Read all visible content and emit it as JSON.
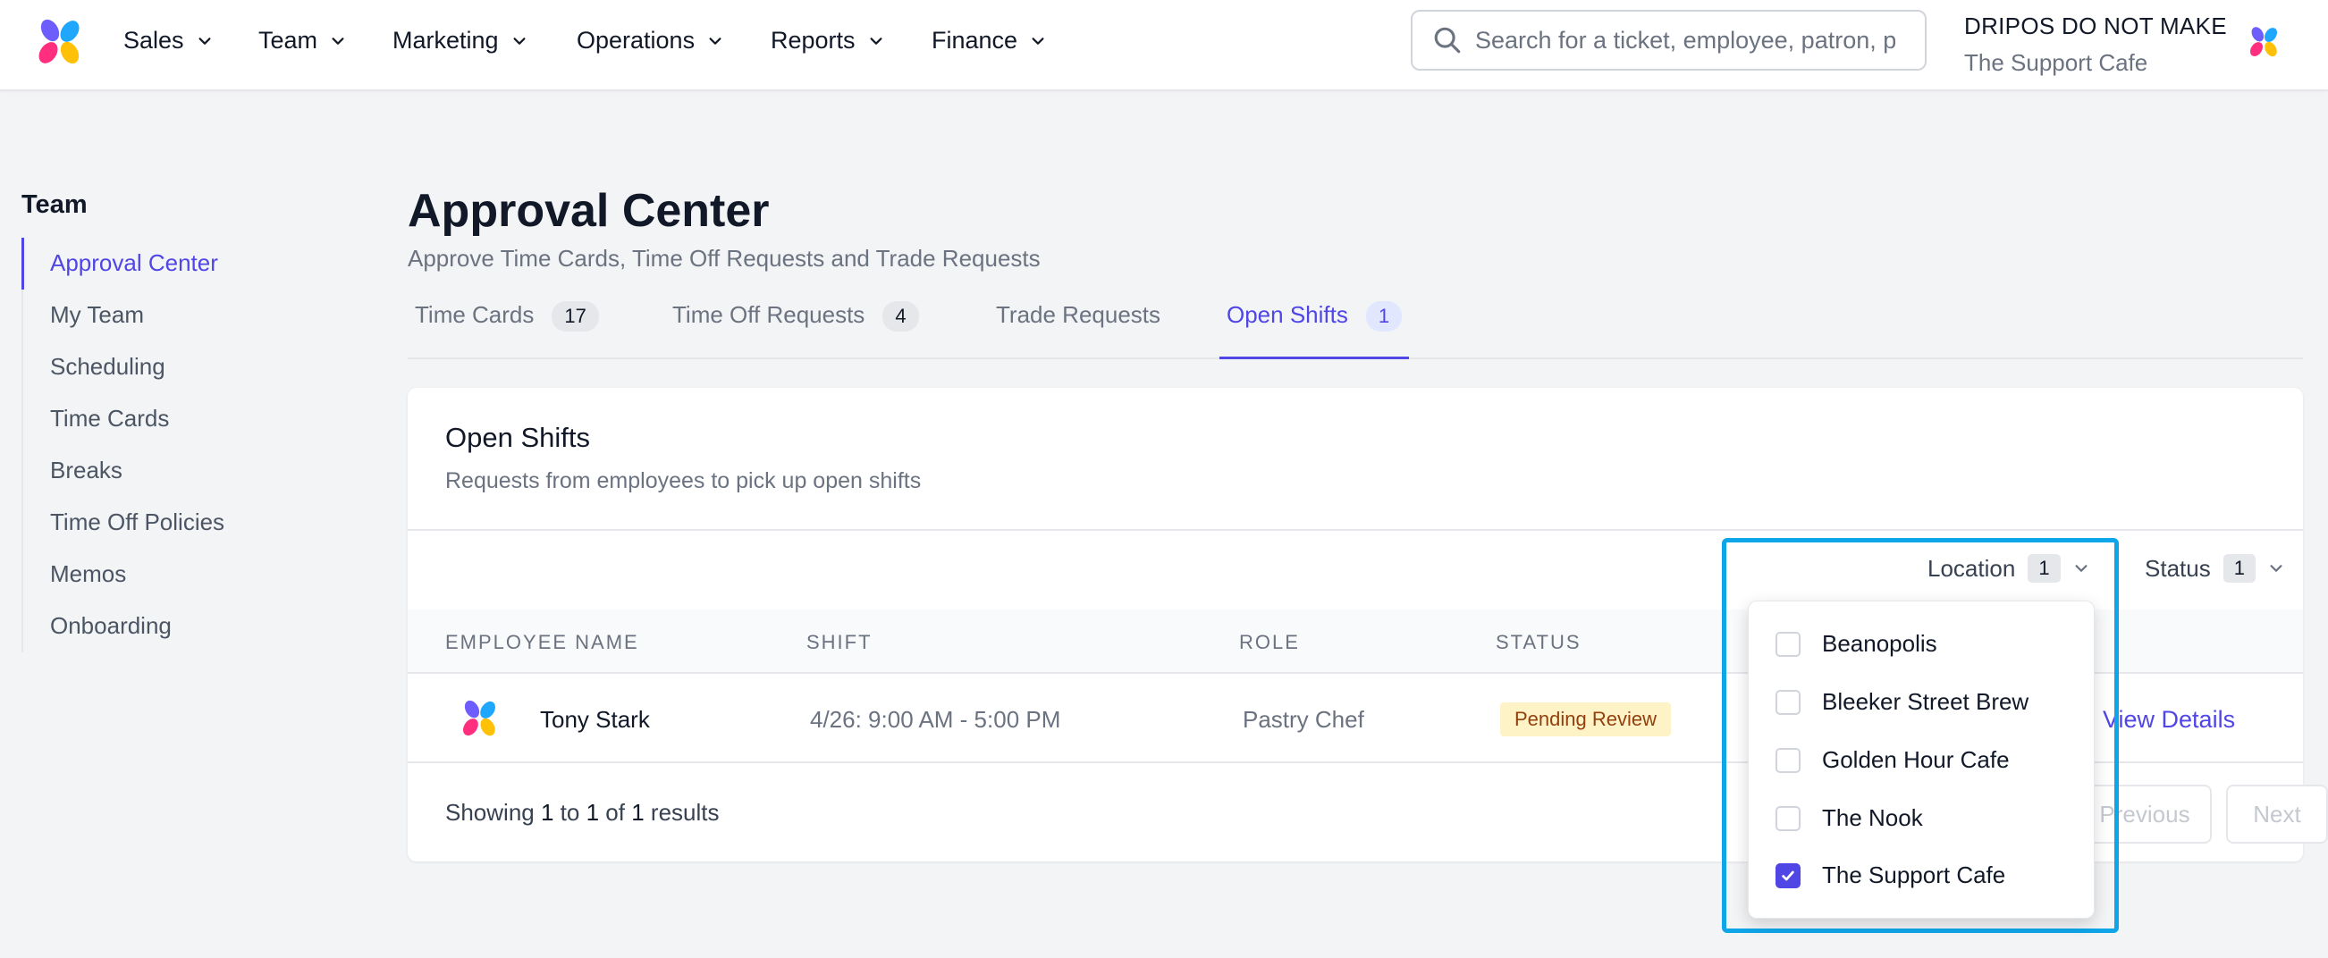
{
  "nav": {
    "items": [
      {
        "label": "Sales"
      },
      {
        "label": "Team"
      },
      {
        "label": "Marketing"
      },
      {
        "label": "Operations"
      },
      {
        "label": "Reports"
      },
      {
        "label": "Finance"
      }
    ],
    "search_placeholder": "Search for a ticket, employee, patron, p",
    "account_name": "DRIPOS DO NOT MAKE",
    "account_location": "The Support Cafe"
  },
  "sidebar": {
    "title": "Team",
    "items": [
      {
        "label": "Approval Center",
        "active": true
      },
      {
        "label": "My Team"
      },
      {
        "label": "Scheduling"
      },
      {
        "label": "Time Cards"
      },
      {
        "label": "Breaks"
      },
      {
        "label": "Time Off Policies"
      },
      {
        "label": "Memos"
      },
      {
        "label": "Onboarding"
      }
    ]
  },
  "page": {
    "title": "Approval Center",
    "subtitle": "Approve Time Cards, Time Off Requests and Trade Requests"
  },
  "tabs": [
    {
      "label": "Time Cards",
      "count": "17"
    },
    {
      "label": "Time Off Requests",
      "count": "4"
    },
    {
      "label": "Trade Requests",
      "count": ""
    },
    {
      "label": "Open Shifts",
      "count": "1",
      "active": true
    }
  ],
  "card": {
    "title": "Open Shifts",
    "subtitle": "Requests from employees to pick up open shifts",
    "filters": {
      "location": {
        "label": "Location",
        "count": "1"
      },
      "status": {
        "label": "Status",
        "count": "1"
      }
    },
    "columns": [
      "EMPLOYEE NAME",
      "SHIFT",
      "ROLE",
      "STATUS"
    ],
    "rows": [
      {
        "name": "Tony Stark",
        "shift": "4/26: 9:00 AM - 5:00 PM",
        "role": "Pastry Chef",
        "status": "Pending Review",
        "action": "View Details"
      }
    ],
    "footer": {
      "prefix": "Showing",
      "from": "1",
      "to_word": "to",
      "to": "1",
      "of_word": "of",
      "total": "1",
      "suffix": "results",
      "prev": "Previous",
      "next": "Next"
    }
  },
  "location_dropdown": {
    "options": [
      {
        "label": "Beanopolis",
        "checked": false
      },
      {
        "label": "Bleeker Street Brew",
        "checked": false
      },
      {
        "label": "Golden Hour Cafe",
        "checked": false
      },
      {
        "label": "The Nook",
        "checked": false
      },
      {
        "label": "The Support Cafe",
        "checked": true
      }
    ]
  },
  "colors": {
    "accent": "#4f46e5",
    "highlight": "#0ea5e9",
    "badge_bg": "#fef3c7",
    "badge_text": "#92400e"
  }
}
